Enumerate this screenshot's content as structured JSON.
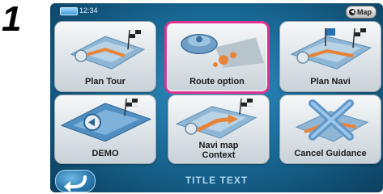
{
  "step_number": "1",
  "status_bar": {
    "time": "12:34",
    "map_button_label": "Map"
  },
  "menu": {
    "tiles": [
      {
        "id": "plan-tour",
        "label": "Plan Tour",
        "icon": "plan-tour-icon",
        "selected": false
      },
      {
        "id": "route-option",
        "label": "Route option",
        "icon": "route-option-icon",
        "selected": true
      },
      {
        "id": "plan-navi",
        "label": "Plan Navi",
        "icon": "plan-navi-icon",
        "selected": false
      },
      {
        "id": "demo",
        "label": "DEMO",
        "icon": "demo-icon",
        "selected": false
      },
      {
        "id": "navi-map-context",
        "label": "Navi map Context",
        "label_line1": "Navi map",
        "label_line2": "Context",
        "icon": "navi-map-context-icon",
        "selected": false
      },
      {
        "id": "cancel-guidance",
        "label": "Cancel Guidance",
        "icon": "cancel-guidance-icon",
        "selected": false
      }
    ]
  },
  "bottom_bar": {
    "title": "TITLE TEXT",
    "back_icon": "back-arrow-icon"
  },
  "colors": {
    "screen_background": "#17648f",
    "selection_highlight": "#e0338f",
    "tile_face": "#dfe5e9",
    "title_text": "#a9d5ef"
  }
}
